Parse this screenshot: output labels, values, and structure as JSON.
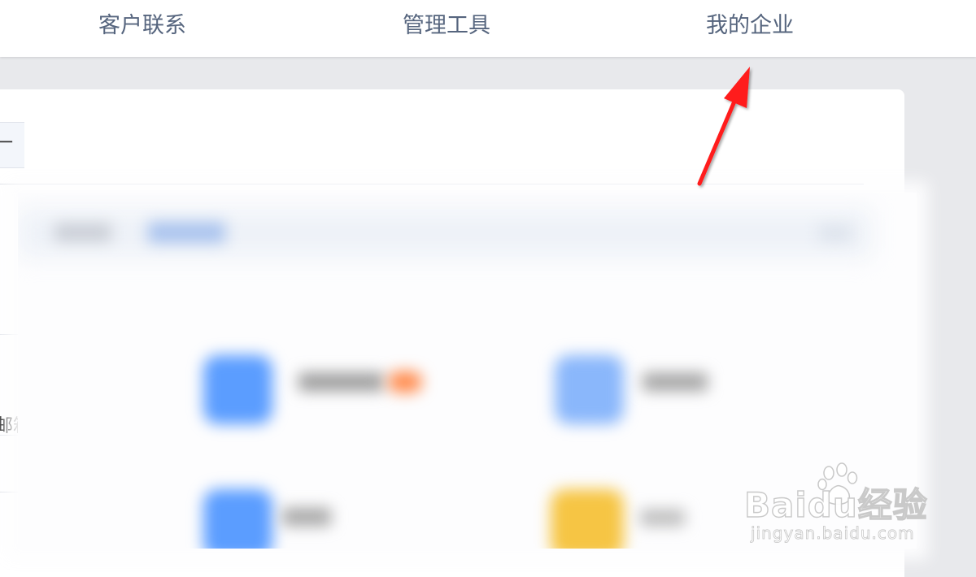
{
  "nav": {
    "items": [
      {
        "label": "客户联系"
      },
      {
        "label": "管理工具"
      },
      {
        "label": "我的企业"
      }
    ]
  },
  "content": {
    "partial_tab_char": "一",
    "partial_item_char": "邮箱"
  },
  "annotation": {
    "arrow_color": "#ff1a1a",
    "points_to": "nav-item-my-company"
  },
  "watermark": {
    "logo_text": "Baidu经验",
    "url": "jingyan.baidu.com"
  },
  "colors": {
    "nav_text": "#56657e",
    "background": "#e8e9ec",
    "app_icon_blue": "#5b9dff",
    "app_icon_yellow": "#f6c544",
    "badge_orange": "#ff8a4c"
  }
}
